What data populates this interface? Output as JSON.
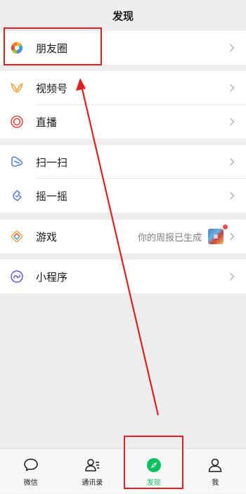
{
  "header": {
    "title": "发现"
  },
  "items": [
    {
      "label": "朋友圈",
      "icon": "moments-icon"
    },
    {
      "label": "视频号",
      "icon": "channels-icon"
    },
    {
      "label": "直播",
      "icon": "live-icon"
    },
    {
      "label": "扫一扫",
      "icon": "scan-icon"
    },
    {
      "label": "摇一摇",
      "icon": "shake-icon"
    },
    {
      "label": "游戏",
      "icon": "game-icon",
      "right_text": "你的周报已生成"
    },
    {
      "label": "小程序",
      "icon": "mini-program-icon"
    }
  ],
  "tabbar": [
    {
      "label": "微信",
      "icon": "chat-bubble-icon"
    },
    {
      "label": "通讯录",
      "icon": "contacts-icon"
    },
    {
      "label": "发现",
      "icon": "compass-icon",
      "active": true
    },
    {
      "label": "我",
      "icon": "person-icon"
    }
  ],
  "colors": {
    "accent": "#07c160",
    "annotation": "#e02020",
    "background": "#ededed"
  }
}
